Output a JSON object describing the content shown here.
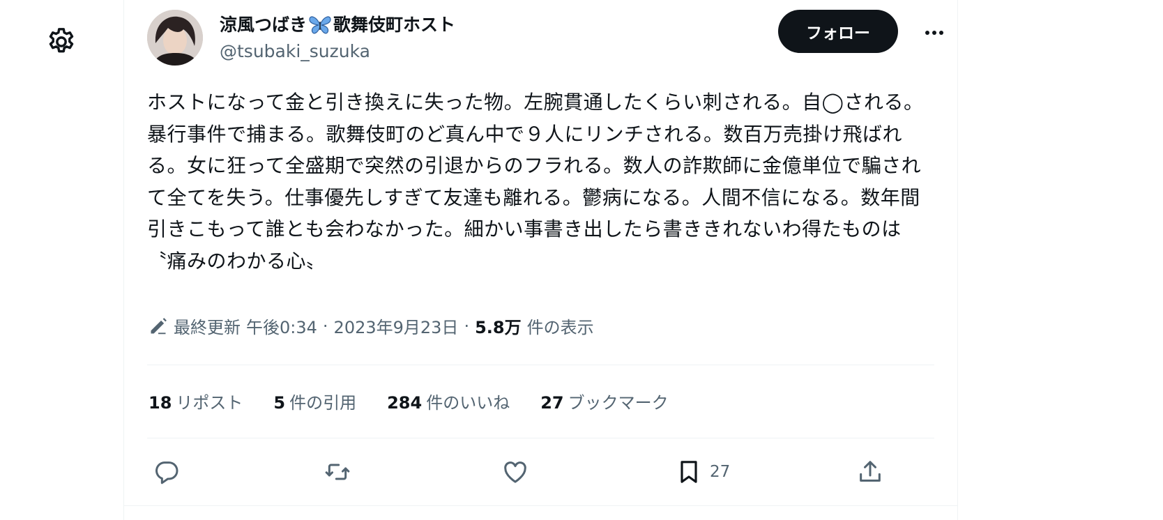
{
  "user": {
    "display_name": "涼風つばき",
    "display_name_suffix": "歌舞伎町ホスト",
    "handle": "@tsubaki_suzuka",
    "name_emoji_icon": "butterfly-icon"
  },
  "follow_label": "フォロー",
  "tweet": {
    "text": "ホストになって金と引き換えに失った物。左腕貫通したくらい刺される。自◯される。暴行事件で捕まる。歌舞伎町のど真ん中で９人にリンチされる。数百万売掛け飛ばれる。女に狂って全盛期で突然の引退からのフラれる。数人の詐欺師に金億単位で騙されて全てを失う。仕事優先しすぎて友達も離れる。鬱病になる。人間不信になる。数年間引きこもって誰とも会わなかった。細かい事書き出したら書ききれないわ得たものは〝痛みのわかる心〟"
  },
  "meta": {
    "edited_label": "最終更新",
    "time": "午後0:34",
    "dot1": "·",
    "date": "2023年9月23日",
    "dot2": "·",
    "views": "5.8万",
    "views_label": "件の表示"
  },
  "stats": [
    {
      "num": "18",
      "label": "リポスト"
    },
    {
      "num": "5",
      "label": "件の引用"
    },
    {
      "num": "284",
      "label": "件のいいね"
    },
    {
      "num": "27",
      "label": "ブックマーク"
    }
  ],
  "actions": {
    "reply_icon": "reply-icon",
    "retweet_icon": "retweet-icon",
    "like_icon": "heart-icon",
    "bookmark_icon": "bookmark-icon",
    "bookmark_count": "27",
    "share_icon": "share-icon"
  },
  "colors": {
    "text": "#0f1419",
    "secondary": "#536471",
    "divider": "#eff3f4",
    "follow_bg": "#0f1419",
    "butterfly": "#4a90e2"
  }
}
